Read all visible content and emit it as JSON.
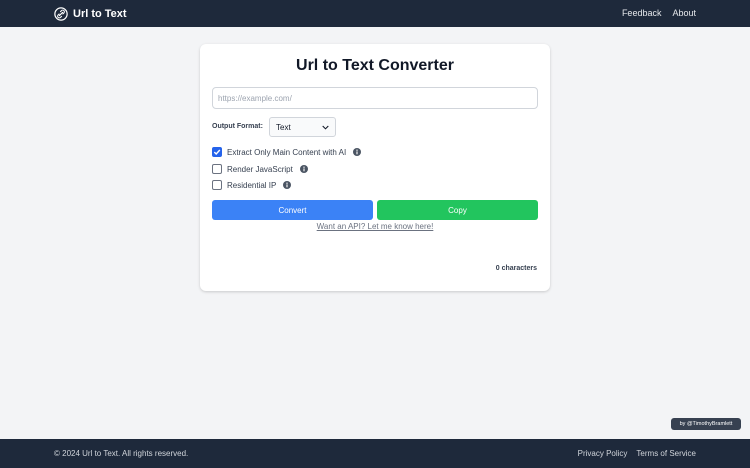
{
  "navbar": {
    "brand": "Url to Text",
    "brand_icon": "link-icon",
    "links": [
      "Feedback",
      "About"
    ]
  },
  "main": {
    "title": "Url to Text Converter",
    "url_input": {
      "placeholder": "https://example.com/",
      "value": ""
    },
    "output_format": {
      "label": "Output Format:",
      "selected": "Text"
    },
    "options": [
      {
        "label": "Extract Only Main Content with AI",
        "checked": true,
        "icon": "info-icon"
      },
      {
        "label": "Render JavaScript",
        "checked": false,
        "icon": "info-icon"
      },
      {
        "label": "Residential IP",
        "checked": false,
        "icon": "info-icon"
      }
    ],
    "convert_label": "Convert",
    "copy_label": "Copy",
    "api_link": "Want an API? Let me know here!",
    "char_count": "0 characters"
  },
  "credit": "by @TimothyBramlett",
  "footer": {
    "copyright": "© 2024 Url to Text. All rights reserved.",
    "links": [
      "Privacy Policy",
      "Terms of Service"
    ]
  },
  "colors": {
    "navbar_bg": "#1e293b",
    "convert_button": "#3b82f6",
    "copy_button": "#22c55e",
    "checkbox_checked": "#2563eb",
    "page_bg": "#f3f4f6"
  }
}
